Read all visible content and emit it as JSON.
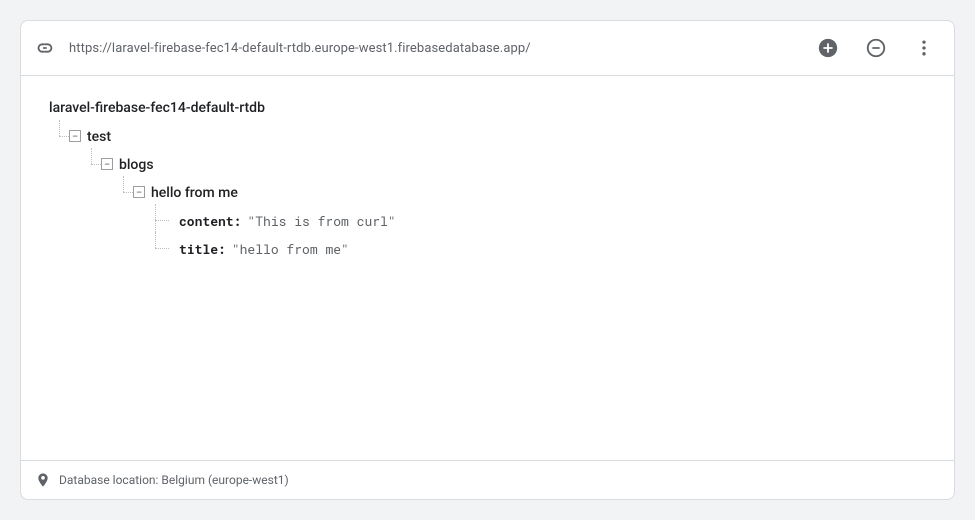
{
  "header": {
    "url": "https://laravel-firebase-fec14-default-rtdb.europe-west1.firebasedatabase.app/"
  },
  "root_name": "laravel-firebase-fec14-default-rtdb",
  "tree": {
    "test": {
      "label": "test",
      "blogs": {
        "label": "blogs",
        "hello_from_me": {
          "label": "hello from me",
          "content_key": "content",
          "content_val": "\"This is from curl\"",
          "title_key": "title",
          "title_val": "\"hello from me\""
        }
      }
    }
  },
  "footer": {
    "location_text": "Database location: Belgium (europe-west1)"
  }
}
